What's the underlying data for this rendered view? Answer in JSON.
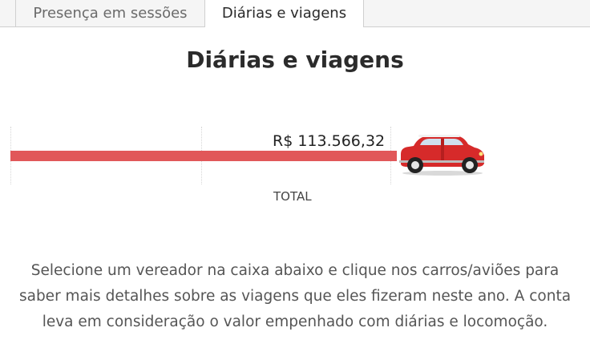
{
  "tabs": [
    {
      "label": "Presença em sessões",
      "active": false
    },
    {
      "label": "Diárias e viagens",
      "active": true
    }
  ],
  "title": "Diárias e viagens",
  "chart_data": {
    "type": "bar",
    "orientation": "horizontal",
    "categories": [
      "TOTAL"
    ],
    "values": [
      113566.32
    ],
    "data_labels": [
      "R$ 113.566,32"
    ],
    "bar_color": "#e15759",
    "marker_icon": "car-icon",
    "xlabel": "",
    "ylabel": ""
  },
  "description": "Selecione um vereador na caixa abaixo e clique nos carros/aviões  para saber mais detalhes sobre as viagens que eles fizeram neste ano. A conta leva em consideração o valor empenhado com diárias e locomoção."
}
